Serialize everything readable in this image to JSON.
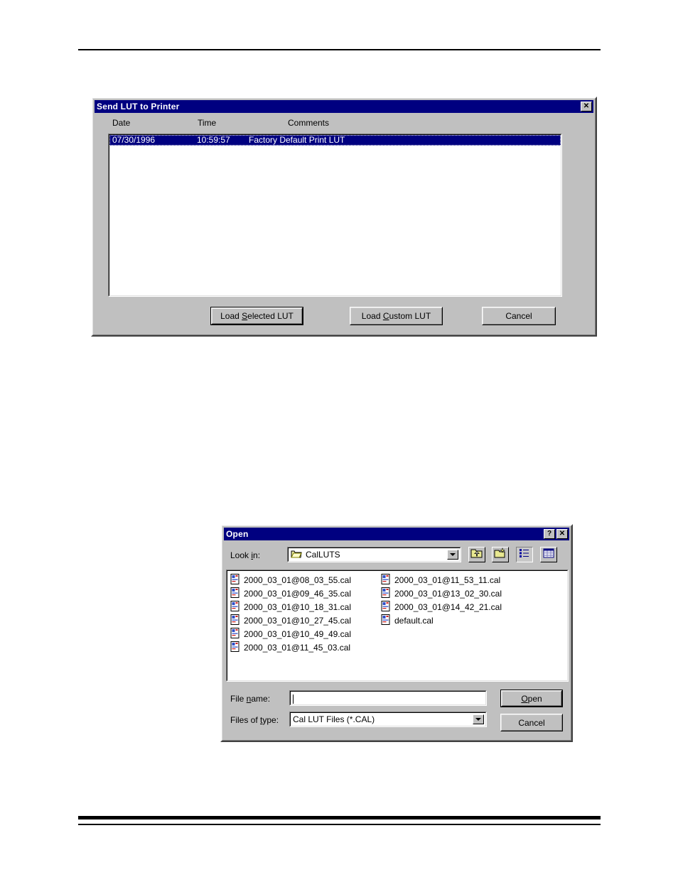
{
  "page": {
    "rule_top": "horizontal-rule",
    "rule_bottom": "horizontal-rule-pair"
  },
  "send_lut_dialog": {
    "title": "Send LUT to Printer",
    "close_label": "✕",
    "close_icon": "close-icon",
    "columns": [
      {
        "label": "Date"
      },
      {
        "label": "Time"
      },
      {
        "label": "Comments"
      }
    ],
    "rows": [
      {
        "date": "07/30/1996",
        "time": "10:59:57",
        "comments": "Factory Default Print LUT",
        "selected": true
      }
    ],
    "buttons": {
      "load_selected": {
        "pre": "Load ",
        "accel": "S",
        "post": "elected LUT"
      },
      "load_custom": {
        "pre": "Load ",
        "accel": "C",
        "post": "ustom LUT"
      },
      "cancel": {
        "pre": "",
        "accel": "",
        "post": "Cancel"
      }
    }
  },
  "open_dialog": {
    "title": "Open",
    "help_label": "?",
    "help_icon": "help-icon",
    "close_label": "✕",
    "close_icon": "close-icon",
    "look_in": {
      "label_pre": "Look ",
      "label_accel": "i",
      "label_post": "n:",
      "value": "CalLUTS",
      "folder_icon": "open-folder-icon",
      "dropdown_icon": "chevron-down-icon"
    },
    "toolbar": [
      {
        "name": "up-one-level",
        "icon": "folder-up-icon"
      },
      {
        "name": "create-new-folder",
        "icon": "new-folder-icon"
      },
      {
        "name": "list-view",
        "icon": "list-view-icon",
        "pressed": true
      },
      {
        "name": "details-view",
        "icon": "details-view-icon",
        "pressed": false
      }
    ],
    "files": {
      "file_icon": "cal-file-icon",
      "column1": [
        "2000_03_01@08_03_55.cal",
        "2000_03_01@09_46_35.cal",
        "2000_03_01@10_18_31.cal",
        "2000_03_01@10_27_45.cal",
        "2000_03_01@10_49_49.cal",
        "2000_03_01@11_45_03.cal"
      ],
      "column2": [
        "2000_03_01@11_53_11.cal",
        "2000_03_01@13_02_30.cal",
        "2000_03_01@14_42_21.cal",
        "default.cal"
      ]
    },
    "file_name": {
      "label_pre": "File ",
      "label_accel": "n",
      "label_post": "ame:",
      "value": "",
      "placeholder": ""
    },
    "files_of_type": {
      "label_pre": "Files of ",
      "label_accel": "t",
      "label_post": "ype:",
      "value": "Cal LUT Files (*.CAL)",
      "dropdown_icon": "chevron-down-icon"
    },
    "buttons": {
      "open": {
        "pre": "",
        "accel": "O",
        "post": "pen"
      },
      "cancel": {
        "pre": "",
        "accel": "",
        "post": "Cancel"
      }
    }
  },
  "colors": {
    "titlebar": "#000080",
    "face": "#c0c0c0",
    "selection": "#000080",
    "window": "#ffffff",
    "folder_yellow": "#ffff99"
  }
}
